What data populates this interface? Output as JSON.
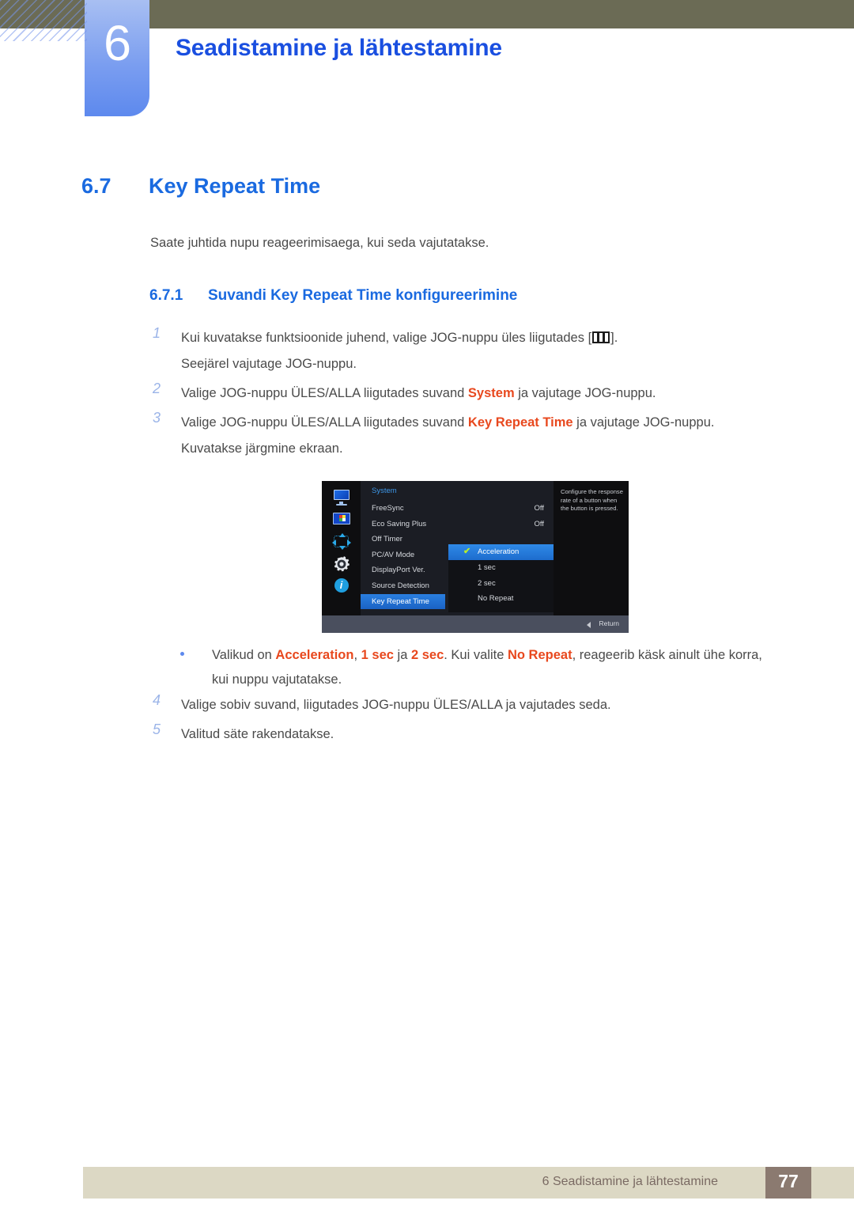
{
  "header": {
    "chapter_number": "6",
    "chapter_title": "Seadistamine ja lähtestamine"
  },
  "section": {
    "number": "6.7",
    "title": "Key Repeat Time",
    "lead": "Saate juhtida nupu reageerimisaega, kui seda vajutatakse.",
    "sub_number": "6.7.1",
    "sub_title": "Suvandi Key Repeat Time konfigureerimine"
  },
  "steps": [
    {
      "num": "1",
      "line1_a": "Kui kuvatakse funktsioonide juhend, valige JOG-nuppu üles liigutades [",
      "line1_b": "].",
      "line2": "Seejärel vajutage JOG-nuppu."
    },
    {
      "num": "2",
      "a": "Valige JOG-nuppu ÜLES/ALLA liigutades suvand ",
      "hl": "System",
      "b": " ja vajutage JOG-nuppu."
    },
    {
      "num": "3",
      "a": "Valige JOG-nuppu ÜLES/ALLA liigutades suvand ",
      "hl": "Key Repeat Time",
      "b": " ja vajutage JOG-nuppu.",
      "line2": "Kuvatakse järgmine ekraan."
    }
  ],
  "bullet": {
    "p1": "Valikud on ",
    "hl1": "Acceleration",
    "p2": ", ",
    "hl2": "1 sec",
    "p3": " ja ",
    "hl3": "2 sec",
    "p4": ". Kui valite ",
    "hl4": "No Repeat",
    "p5": ", reageerib käsk ainult ühe korra,",
    "line2": "kui nuppu vajutatakse."
  },
  "steps_tail": [
    {
      "num": "4",
      "text": "Valige sobiv suvand, liigutades JOG-nuppu ÜLES/ALLA ja vajutades seda."
    },
    {
      "num": "5",
      "text": "Valitud säte rakendatakse."
    }
  ],
  "osd": {
    "title": "System",
    "icons": [
      "display-icon",
      "picture-color-icon",
      "osd-position-arrows-icon",
      "gear-icon",
      "info-icon"
    ],
    "rows": [
      {
        "label": "FreeSync",
        "value": "Off"
      },
      {
        "label": "Eco Saving Plus",
        "value": "Off"
      },
      {
        "label": "Off Timer",
        "value": ""
      },
      {
        "label": "PC/AV Mode",
        "value": ""
      },
      {
        "label": "DisplayPort Ver.",
        "value": ""
      },
      {
        "label": "Source Detection",
        "value": ""
      },
      {
        "label": "Key Repeat Time",
        "value": "",
        "selected": true
      }
    ],
    "submenu": [
      {
        "label": "Acceleration",
        "selected": true,
        "check": "✔"
      },
      {
        "label": "1 sec",
        "selected": false
      },
      {
        "label": "2 sec",
        "selected": false
      },
      {
        "label": "No Repeat",
        "selected": false
      }
    ],
    "help": "Configure the response rate of a button when the button is pressed.",
    "return_label": "Return"
  },
  "footer": {
    "text": "6 Seadistamine ja lähtestamine",
    "page": "77"
  },
  "colors": {
    "heading_blue": "#1a6ae0",
    "chapter_blue": "#1a4fe0",
    "highlight_orange": "#e8481e",
    "header_olive": "#6b6b55",
    "footer_beige": "#dcd8c4",
    "footer_page_box": "#8b7a70",
    "tab_blue": "#5d89ee",
    "osd_select_blue": "#2a7fe0"
  }
}
